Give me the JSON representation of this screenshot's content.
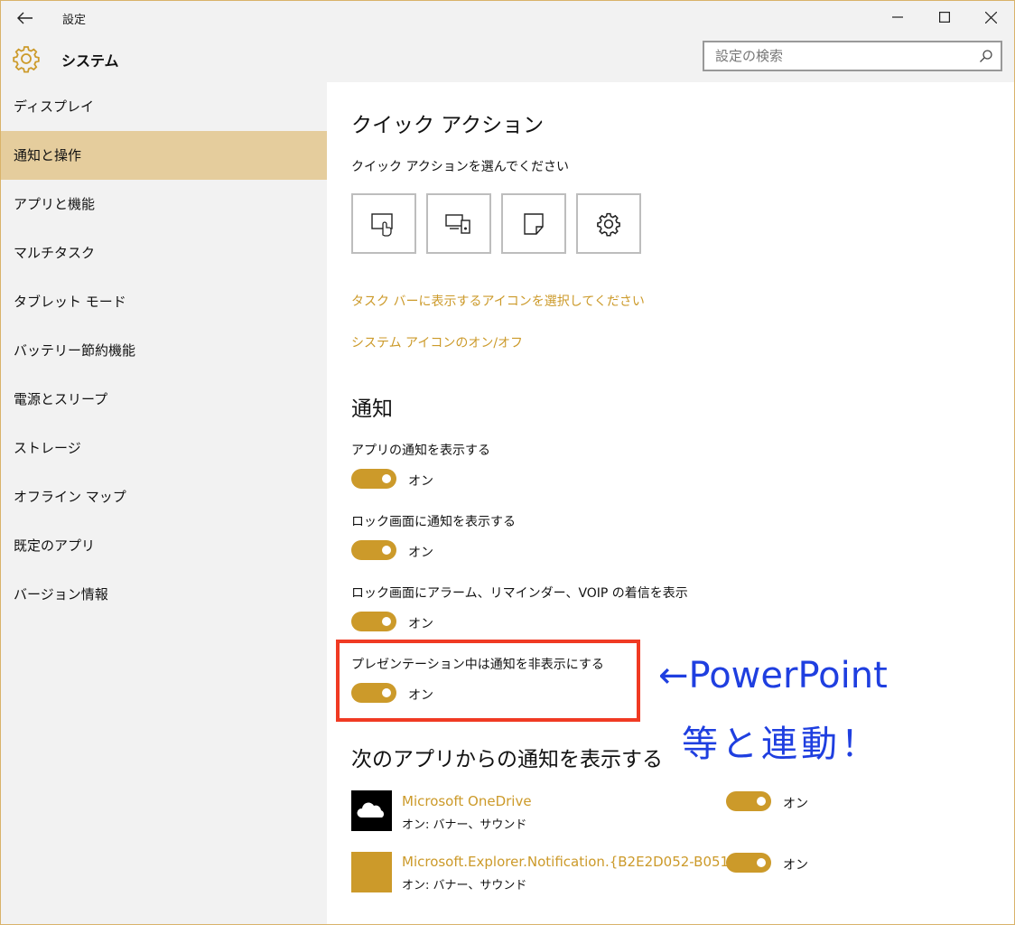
{
  "titlebar": {
    "title": "設定"
  },
  "header": {
    "title": "システム",
    "search_placeholder": "設定の検索"
  },
  "sidebar": {
    "items": [
      {
        "label": "ディスプレイ",
        "active": false
      },
      {
        "label": "通知と操作",
        "active": true
      },
      {
        "label": "アプリと機能",
        "active": false
      },
      {
        "label": "マルチタスク",
        "active": false
      },
      {
        "label": "タブレット モード",
        "active": false
      },
      {
        "label": "バッテリー節約機能",
        "active": false
      },
      {
        "label": "電源とスリープ",
        "active": false
      },
      {
        "label": "ストレージ",
        "active": false
      },
      {
        "label": "オフライン マップ",
        "active": false
      },
      {
        "label": "既定のアプリ",
        "active": false
      },
      {
        "label": "バージョン情報",
        "active": false
      }
    ]
  },
  "quick_actions": {
    "heading": "クイック アクション",
    "subheading": "クイック アクションを選んでください",
    "tiles": [
      "tablet-mode-icon",
      "project-icon",
      "note-icon",
      "settings-gear-icon"
    ],
    "link_taskbar_icons": "タスク バーに表示するアイコンを選択してください",
    "link_system_icons": "システム アイコンのオン/オフ"
  },
  "notifications": {
    "heading": "通知",
    "settings": [
      {
        "label": "アプリの通知を表示する",
        "state": "オン"
      },
      {
        "label": "ロック画面に通知を表示する",
        "state": "オン"
      },
      {
        "label": "ロック画面にアラーム、リマインダー、VOIP の着信を表示",
        "state": "オン"
      },
      {
        "label": "プレゼンテーション中は通知を非表示にする",
        "state": "オン"
      }
    ]
  },
  "apps": {
    "heading": "次のアプリからの通知を表示する",
    "items": [
      {
        "name": "Microsoft OneDrive",
        "sub": "オン: バナー、サウンド",
        "state": "オン"
      },
      {
        "name": "Microsoft.Explorer.Notification.{B2E2D052-B051-",
        "sub": "オン: バナー、サウンド",
        "state": "オン"
      }
    ]
  },
  "annotation": {
    "line1": "←PowerPoint",
    "line2": "等と連動！"
  },
  "colors": {
    "accent": "#cc9a2a",
    "selected": "#e5cd9d",
    "highlight": "#f03a23",
    "annotation": "#1f3fe0"
  }
}
